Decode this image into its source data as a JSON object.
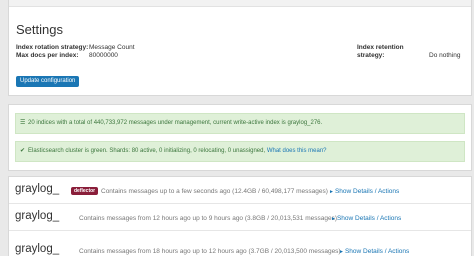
{
  "settings": {
    "title": "Settings",
    "rotation_strategy_label": "Index rotation strategy:",
    "rotation_strategy_value": "Message Count",
    "max_docs_label": "Max docs per index:",
    "max_docs_value": "80000000",
    "retention_strategy_label": "Index retention strategy:",
    "retention_strategy_value": "Do nothing",
    "update_button": "Update configuration"
  },
  "status": {
    "indices_message": "20 indices with a total of 440,733,972 messages under management, current write-active index is graylog_276.",
    "cluster_message": "Elasticsearch cluster is green. Shards: 80 active, 0 initializing, 0 relocating, 0 unassigned,",
    "cluster_link": "What does this mean?"
  },
  "indices": [
    {
      "name": "graylog_",
      "badge": "deflector",
      "description": "Contains messages up to a few seconds ago (12.4GB / 60,498,177 messages)",
      "show_details": "Show Details",
      "separator": "/",
      "actions": "Actions"
    },
    {
      "name": "graylog_",
      "badge": "",
      "description": "Contains messages from 12 hours ago up to 9 hours ago (3.8GB / 20,013,531 messages)",
      "show_details": "Show Details",
      "separator": "/",
      "actions": "Actions"
    },
    {
      "name": "graylog_",
      "badge": "",
      "description": "Contains messages from 18 hours ago up to 12 hours ago (3.7GB / 20,013,500 messages)",
      "show_details": "Show Details",
      "separator": "/",
      "actions": "Actions"
    }
  ],
  "colors": {
    "primary": "#1a76b4",
    "success_bg": "#dff0d8",
    "success_text": "#3c763d",
    "badge_bg": "#8a1e3a"
  }
}
